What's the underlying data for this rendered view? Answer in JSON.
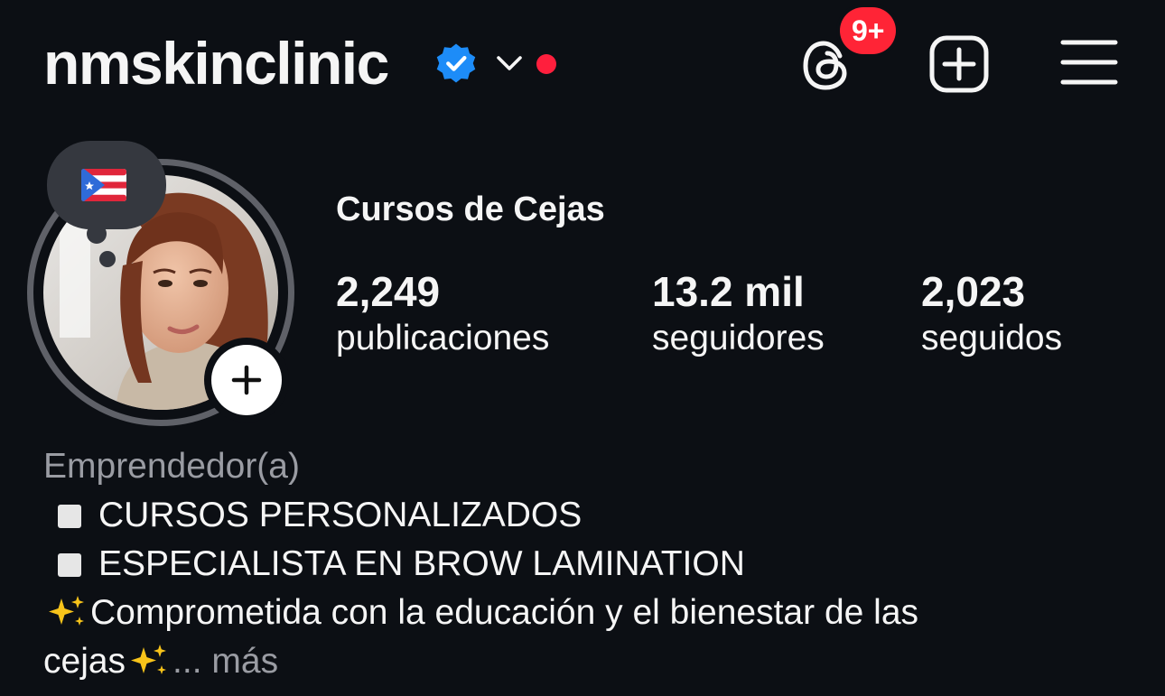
{
  "header": {
    "username": "nmskinclinic",
    "verified_icon": "verified-badge-icon",
    "notification_badge": "9+",
    "icons": [
      "threads-icon",
      "create-post-icon",
      "menu-icon"
    ]
  },
  "profile": {
    "note_emoji": "puerto-rico-flag",
    "display_name": "Cursos de Cejas",
    "stats": {
      "posts": {
        "value": "2,249",
        "label": "publicaciones"
      },
      "followers": {
        "value": "13.2 mil",
        "label": "seguidores"
      },
      "following": {
        "value": "2,023",
        "label": "seguidos"
      }
    }
  },
  "bio": {
    "category": "Emprendedor(a)",
    "line1": "CURSOS PERSONALIZADOS",
    "line2": "ESPECIALISTA EN BROW LAMINATION",
    "line3": "Comprometida con la educación y el bienestar de las",
    "line4": "cejas",
    "ellipsis": "...",
    "more": "más"
  },
  "colors": {
    "background": "#0c0f14",
    "badge_red": "#ff2436",
    "verified_blue": "#1d8cf8",
    "muted_text": "#9a9ca3"
  }
}
